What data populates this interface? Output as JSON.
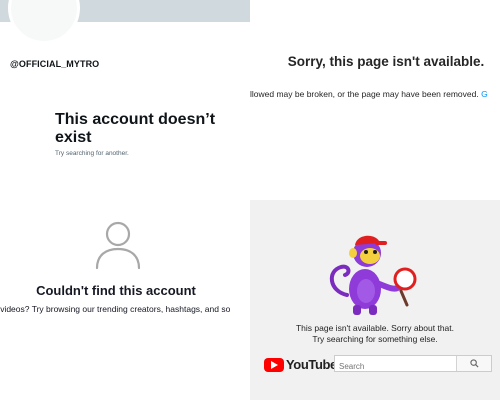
{
  "twitter": {
    "handle": "@OFFICIAL_MYTRO",
    "headline": "This account doesn’t exist",
    "hint": "Try searching for another."
  },
  "instagram": {
    "title": "Sorry, this page isn't available.",
    "body": "llowed may be broken, or the page may have been removed.",
    "link": "G"
  },
  "tiktok": {
    "icon": "person-outline-icon",
    "title": "Couldn't find this account",
    "body": "r videos? Try browsing our trending creators, hashtags, and so"
  },
  "youtube": {
    "message_line1": "This page isn't available. Sorry about that.",
    "message_line2": "Try searching for something else.",
    "logo_text": "YouTube",
    "search_placeholder": "Search",
    "colors": {
      "brand": "#ff0000",
      "background": "#f1f1f1"
    }
  }
}
